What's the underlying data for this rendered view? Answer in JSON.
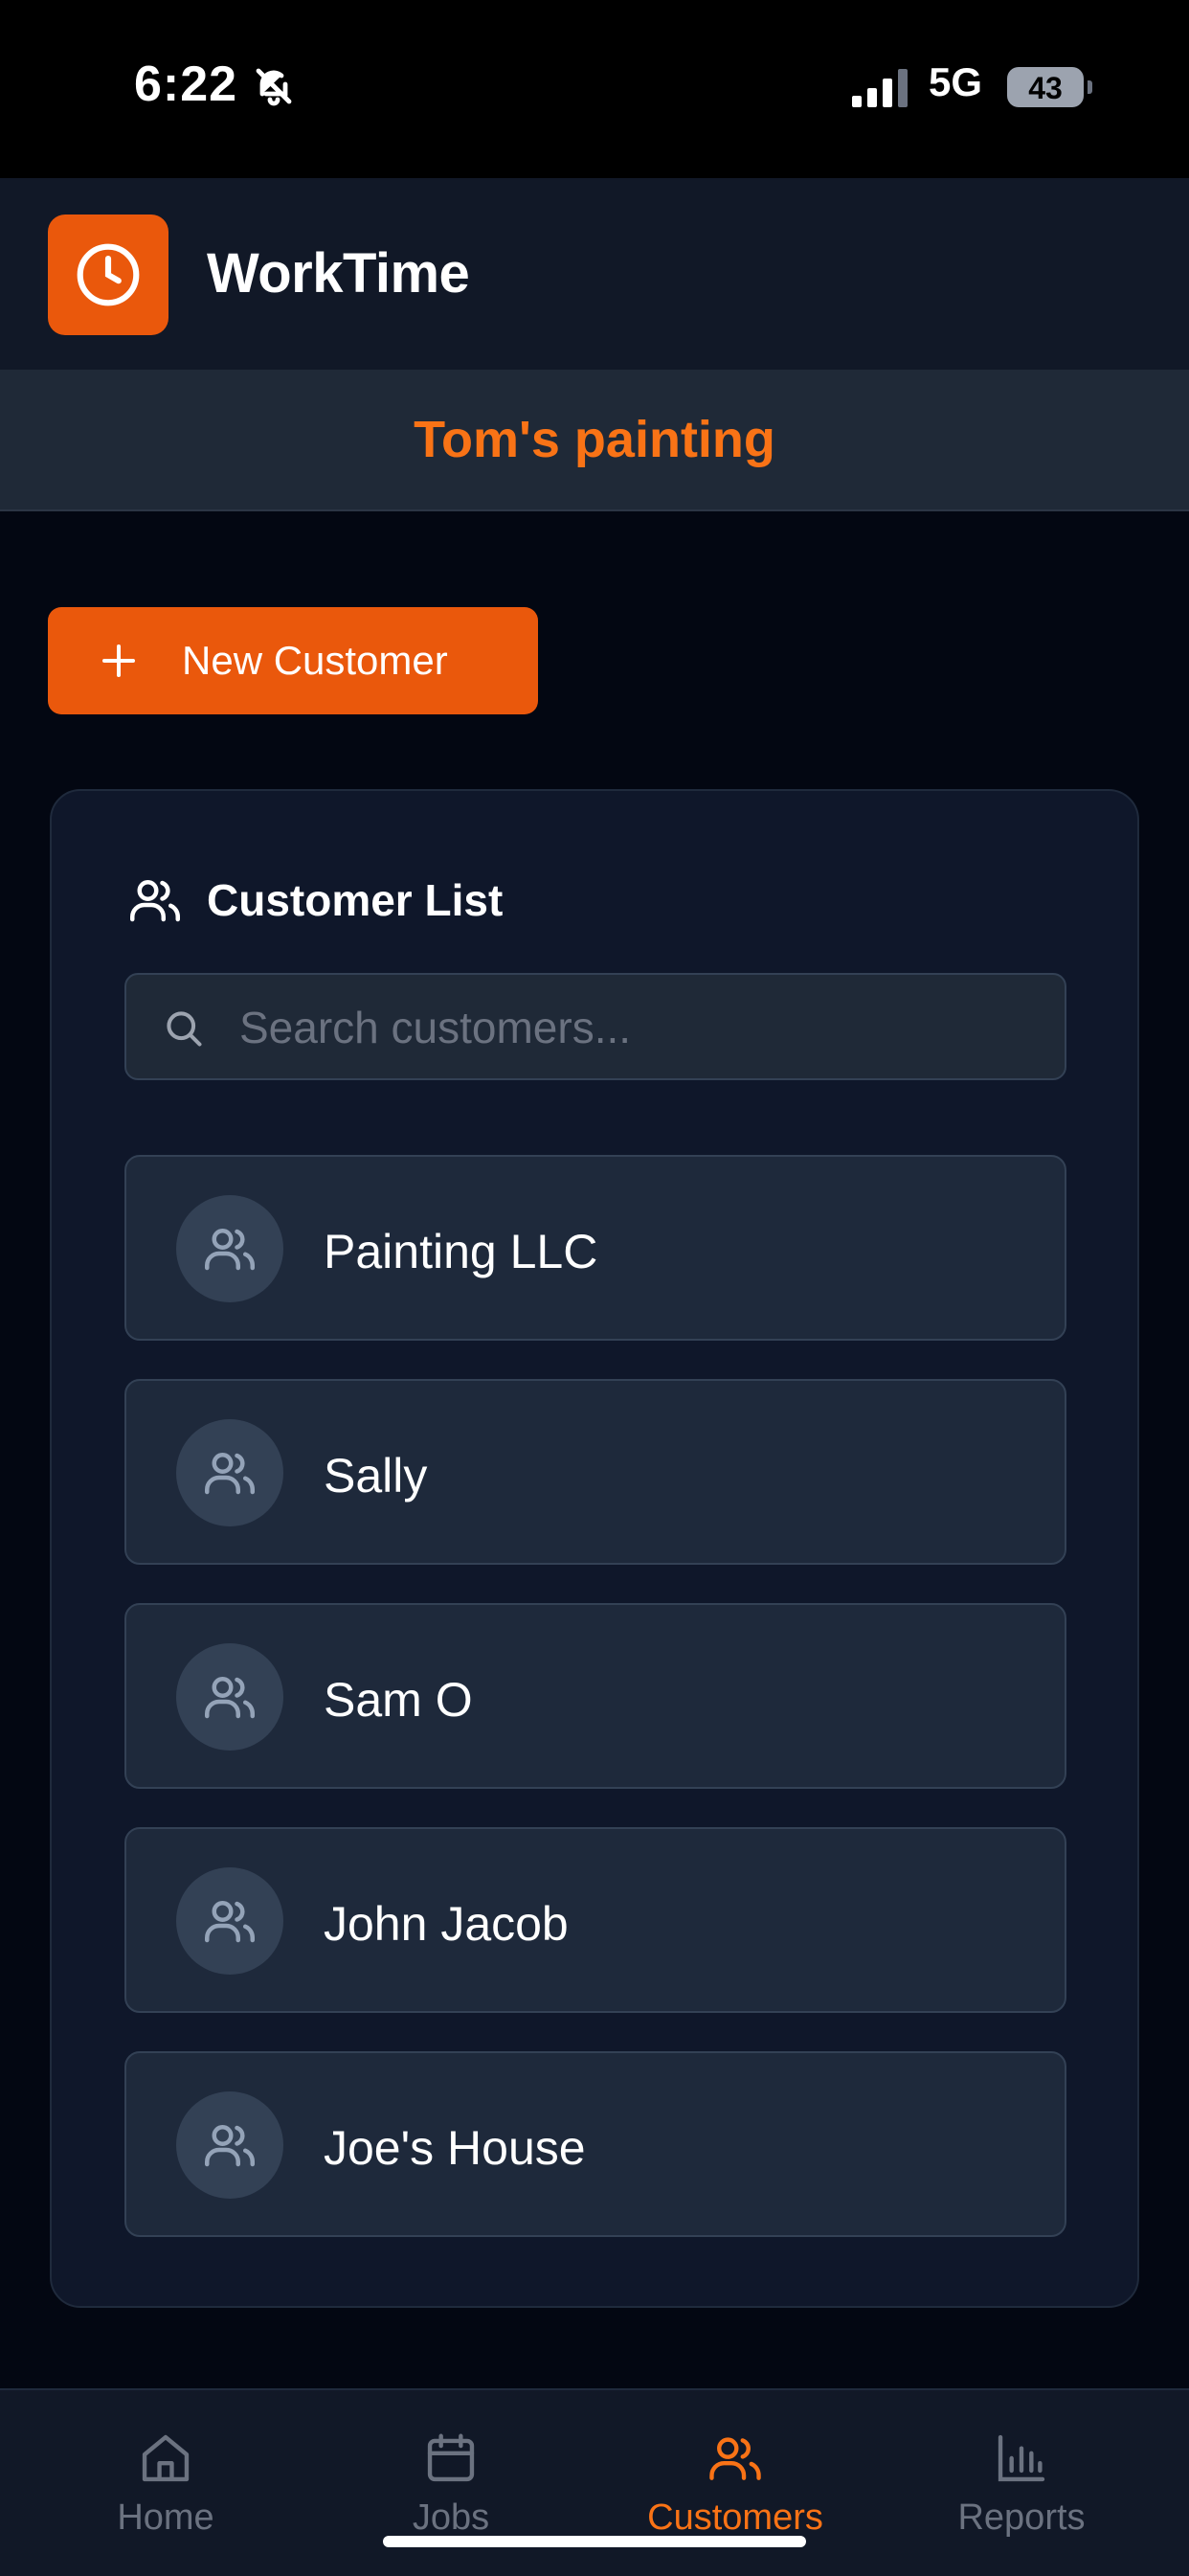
{
  "status_bar": {
    "time": "6:22",
    "network": "5G",
    "battery": "43"
  },
  "app": {
    "title": "WorkTime",
    "company": "Tom's painting"
  },
  "actions": {
    "new_customer": "New Customer"
  },
  "customer_list": {
    "title": "Customer List",
    "search_placeholder": "Search customers...",
    "customers": [
      "Painting LLC",
      "Sally",
      "Sam O",
      "John Jacob",
      "Joe's House"
    ]
  },
  "nav": {
    "tabs": [
      {
        "label": "Home",
        "icon": "home-icon"
      },
      {
        "label": "Jobs",
        "icon": "calendar-icon"
      },
      {
        "label": "Customers",
        "icon": "users-icon",
        "active": true
      },
      {
        "label": "Reports",
        "icon": "bar-chart-icon"
      }
    ]
  },
  "colors": {
    "accent": "#ea580c",
    "accent_text": "#f97316",
    "background": "#030712",
    "card": "#0f172a",
    "row": "#1e293b"
  }
}
